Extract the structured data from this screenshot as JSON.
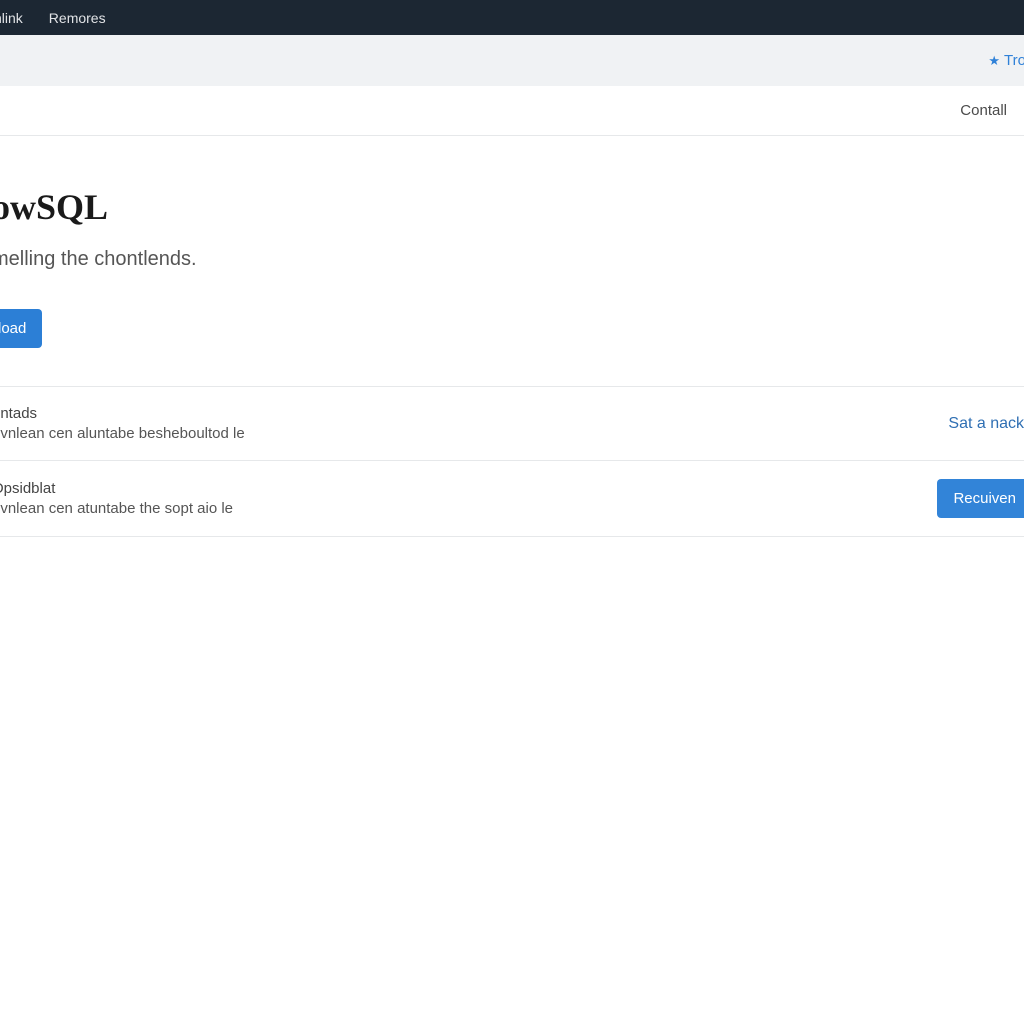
{
  "topnav": {
    "items": [
      "nlink",
      "Remores"
    ]
  },
  "subnav": {
    "star_link": "Tro"
  },
  "tabs": {
    "contall": "Contall"
  },
  "hero": {
    "title": "owSQL",
    "subtitle": "melling the chontlends.",
    "button_label": "load"
  },
  "rows": [
    {
      "title": "ontads",
      "desc": "ovnlean cen aluntabe besheboultod le",
      "action_label": "Sat a nack",
      "action_type": "link"
    },
    {
      "title": "Opsidblat",
      "desc": "ovnlean cen atuntabe the sopt aio le",
      "action_label": "Recuiven",
      "action_type": "button"
    }
  ]
}
